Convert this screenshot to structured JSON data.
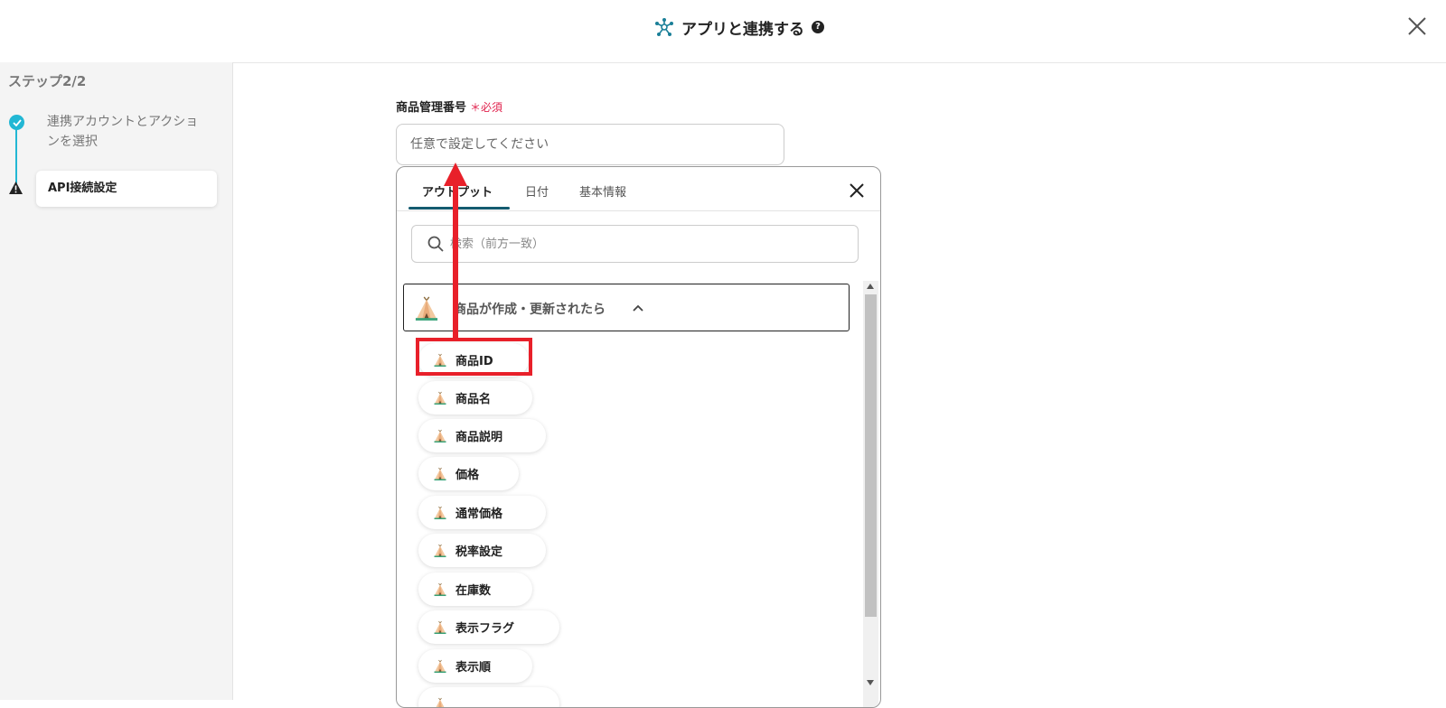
{
  "header": {
    "title": "アプリと連携する",
    "help_icon": "?"
  },
  "sidebar": {
    "step_title": "ステップ2/2",
    "steps": [
      {
        "label": "連携アカウントとアクションを選択",
        "status": "completed"
      },
      {
        "label": "API接続設定",
        "status": "warning"
      }
    ]
  },
  "field": {
    "label": "商品管理番号",
    "required_mark": "＊必須",
    "placeholder": "任意で設定してください"
  },
  "picker": {
    "tabs": [
      {
        "label": "アウトプット"
      },
      {
        "label": "日付"
      },
      {
        "label": "基本情報"
      }
    ],
    "search_placeholder": "検索（前方一致）",
    "group_label": "商品が作成・更新されたら",
    "items": [
      {
        "label": "商品ID"
      },
      {
        "label": "商品名"
      },
      {
        "label": "商品説明"
      },
      {
        "label": "価格"
      },
      {
        "label": "通常価格"
      },
      {
        "label": "税率設定"
      },
      {
        "label": "在庫数"
      },
      {
        "label": "表示フラグ"
      },
      {
        "label": "表示順"
      }
    ]
  },
  "colors": {
    "accent": "#22b7d4",
    "annotation": "#e8202a",
    "required": "#e0224d",
    "tab_underline": "#145b70"
  }
}
